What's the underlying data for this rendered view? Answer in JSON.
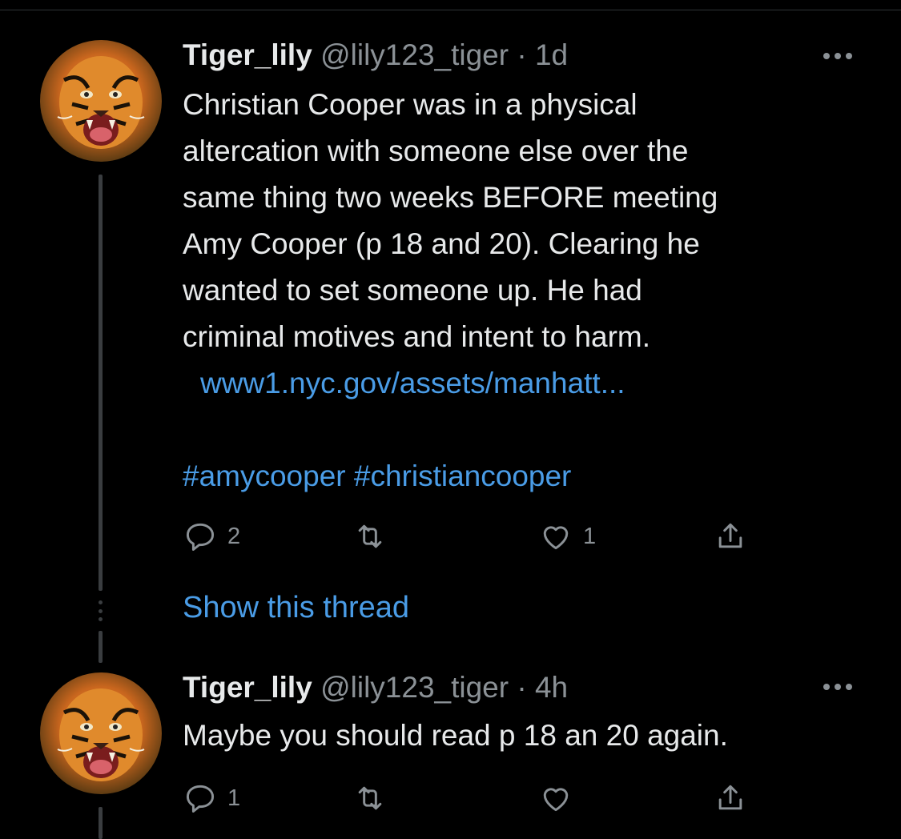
{
  "tweets": [
    {
      "display_name": "Tiger_lily",
      "handle": "@lily123_tiger",
      "time": "· 1d",
      "lines": [
        "Christian Cooper was in a physical",
        "altercation with someone else over the",
        "same thing two weeks BEFORE meeting",
        "Amy Cooper (p 18 and 20).  Clearing he",
        "wanted to set someone up.  He had",
        "criminal motives and intent to harm."
      ],
      "link": "www1.nyc.gov/assets/manhatt...",
      "hashtags": "#amycooper #christiancooper",
      "reply_count": "2",
      "retweet_count": "",
      "like_count": "1"
    },
    {
      "display_name": "Tiger_lily",
      "handle": "@lily123_tiger",
      "time": "· 4h",
      "lines": [
        "Maybe you should read p 18 an 20 again."
      ],
      "reply_count": "1",
      "retweet_count": "",
      "like_count": ""
    }
  ],
  "show_thread_label": "Show this thread",
  "icons": {
    "avatar": "tiger-avatar",
    "more": "more-horizontal-icon",
    "reply": "reply-icon",
    "retweet": "retweet-icon",
    "like": "heart-icon",
    "share": "share-icon"
  },
  "colors": {
    "background": "#000000",
    "link": "#4a9ce6",
    "muted": "#8b9196",
    "text": "#e7e9ea"
  }
}
